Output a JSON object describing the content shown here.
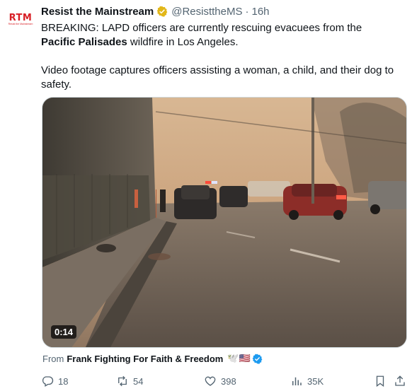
{
  "avatar": {
    "logo_text": "RTM",
    "logo_sub": "Resist the Mainstream"
  },
  "author": {
    "name": "Resist the Mainstream",
    "handle": "@ResisttheMS",
    "separator": "·",
    "time": "16h"
  },
  "tweet": {
    "line1_pre": "BREAKING: LAPD officers are currently rescuing evacuees from the ",
    "line1_bold": "Pacific Palisades",
    "line1_post": " wildfire in Los Angeles.",
    "line2": "Video footage captures officers assisting a woman, a child, and their dog to safety."
  },
  "video": {
    "duration": "0:14"
  },
  "attribution": {
    "prefix": "From",
    "name": "Frank Fighting For Faith & Freedom",
    "emoji": "🕊️🇺🇸"
  },
  "actions": {
    "replies": "18",
    "reposts": "54",
    "likes": "398",
    "views": "35K"
  },
  "colors": {
    "accent": "#1d9bf0",
    "gold": "#e2b719",
    "muted": "#536471",
    "brand_red": "#d81f26"
  }
}
